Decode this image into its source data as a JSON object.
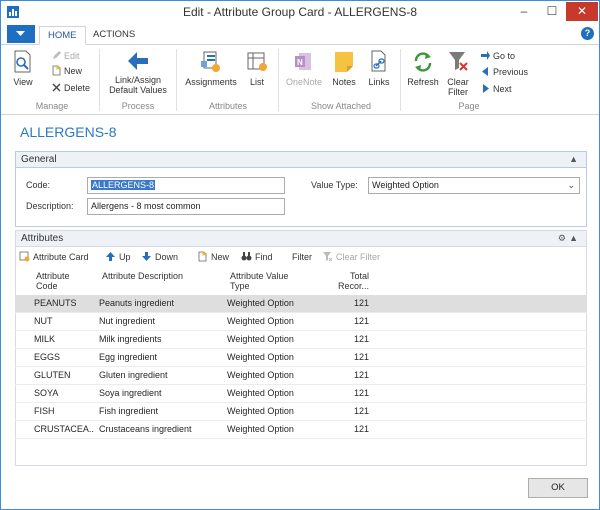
{
  "window": {
    "title": "Edit - Attribute Group Card - ALLERGENS-8",
    "minimize_glyph": "–",
    "maximize_glyph": "☐",
    "close_glyph": "✕"
  },
  "tabs": {
    "home": "HOME",
    "actions": "ACTIONS",
    "help": "?"
  },
  "ribbon": {
    "manage": {
      "label": "Manage",
      "view": "View",
      "edit": "Edit",
      "new": "New",
      "delete": "Delete"
    },
    "process": {
      "label": "Process",
      "link_assign_1": "Link/Assign",
      "link_assign_2": "Default Values"
    },
    "attributes": {
      "label": "Attributes",
      "assignments": "Assignments",
      "list": "List"
    },
    "show_attached": {
      "label": "Show Attached",
      "onenote": "OneNote",
      "notes": "Notes",
      "links": "Links"
    },
    "page": {
      "label": "Page",
      "refresh": "Refresh",
      "clear_filter_1": "Clear",
      "clear_filter_2": "Filter",
      "go_to": "Go to",
      "previous": "Previous",
      "next": "Next"
    }
  },
  "page_title": "ALLERGENS-8",
  "general": {
    "header": "General",
    "code_label": "Code:",
    "code_value": "ALLERGENS-8",
    "description_label": "Description:",
    "description_value": "Allergens - 8 most common",
    "value_type_label": "Value Type:",
    "value_type_value": "Weighted Option"
  },
  "attributes": {
    "header": "Attributes",
    "toolbar": {
      "attribute_card": "Attribute Card",
      "up": "Up",
      "down": "Down",
      "new": "New",
      "find": "Find",
      "filter": "Filter",
      "clear_filter": "Clear Filter"
    },
    "columns": {
      "code_1": "Attribute",
      "code_2": "Code",
      "desc": "Attribute Description",
      "type_1": "Attribute Value",
      "type_2": "Type",
      "total_1": "Total",
      "total_2": "Recor..."
    },
    "rows": [
      {
        "code": "PEANUTS",
        "desc": "Peanuts ingredient",
        "type": "Weighted Option",
        "total": "121"
      },
      {
        "code": "NUT",
        "desc": "Nut ingredient",
        "type": "Weighted Option",
        "total": "121"
      },
      {
        "code": "MILK",
        "desc": "Milk ingredients",
        "type": "Weighted Option",
        "total": "121"
      },
      {
        "code": "EGGS",
        "desc": "Egg ingredient",
        "type": "Weighted Option",
        "total": "121"
      },
      {
        "code": "GLUTEN",
        "desc": "Gluten ingredient",
        "type": "Weighted Option",
        "total": "121"
      },
      {
        "code": "SOYA",
        "desc": "Soya ingredient",
        "type": "Weighted Option",
        "total": "121"
      },
      {
        "code": "FISH",
        "desc": "Fish ingredient",
        "type": "Weighted Option",
        "total": "121"
      },
      {
        "code": "CRUSTACEA...",
        "desc": "Crustaceans ingredient",
        "type": "Weighted Option",
        "total": "121"
      }
    ]
  },
  "ok_label": "OK",
  "colors": {
    "accent": "#1e6fc1",
    "title_blue": "#2a7ac2",
    "close_red": "#c7392a"
  }
}
